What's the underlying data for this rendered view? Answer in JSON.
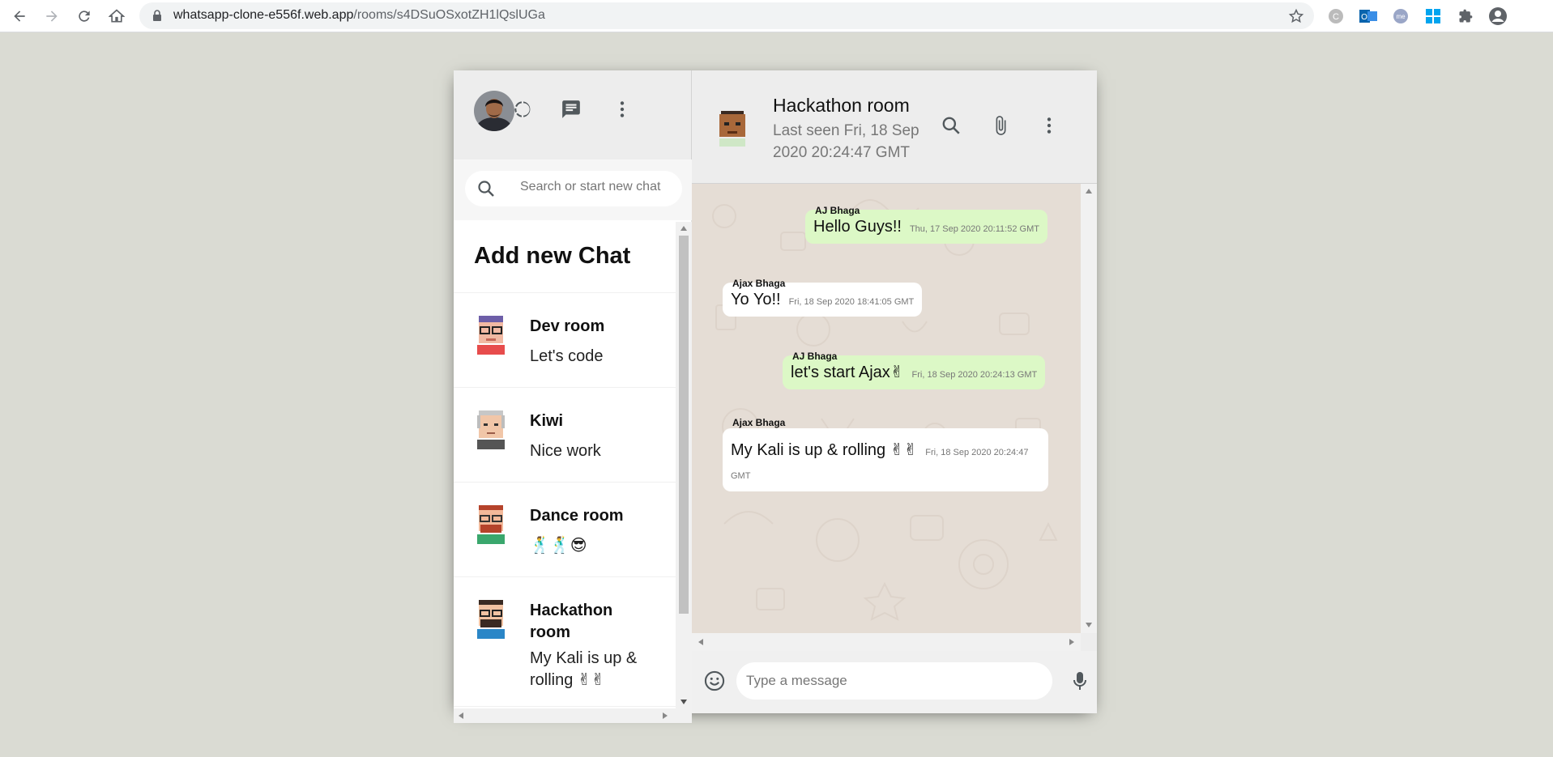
{
  "browser": {
    "url_host": "whatsapp-clone-e556f.web.app",
    "url_path": "/rooms/s4DSuOSxotZH1lQslUGa"
  },
  "sidebar": {
    "search_placeholder": "Search or start new chat",
    "add_chat_label": "Add new Chat",
    "chats": [
      {
        "name": "Dev room",
        "last": "Let's code"
      },
      {
        "name": "Kiwi",
        "last": "Nice work"
      },
      {
        "name": "Dance room",
        "last": "🕺🕺😎"
      },
      {
        "name": "Hackathon room",
        "last": "My Kali is up & rolling ✌✌"
      }
    ]
  },
  "chat": {
    "title": "Hackathon room",
    "last_seen": "Last seen Fri, 18 Sep 2020 20:24:47 GMT",
    "messages": [
      {
        "sender": "AJ Bhaga",
        "text": "Hello Guys!!",
        "time": "Thu, 17 Sep 2020 20:11:52 GMT",
        "sent": true
      },
      {
        "sender": "Ajax Bhaga",
        "text": "Yo Yo!!",
        "time": "Fri, 18 Sep 2020 18:41:05 GMT",
        "sent": false
      },
      {
        "sender": "AJ Bhaga",
        "text": "let's start Ajax✌",
        "time": "Fri, 18 Sep 2020 20:24:13 GMT",
        "sent": true
      },
      {
        "sender": "Ajax Bhaga",
        "text": "My Kali is up & rolling ✌✌",
        "time": "Fri, 18 Sep 2020 20:24:47 GMT",
        "sent": false
      }
    ],
    "input_placeholder": "Type a message"
  },
  "colors": {
    "sent_bubble": "#dcf8c6",
    "received_bubble": "#ffffff",
    "chat_background": "#e5ddd5",
    "app_background": "#dadbd3"
  }
}
